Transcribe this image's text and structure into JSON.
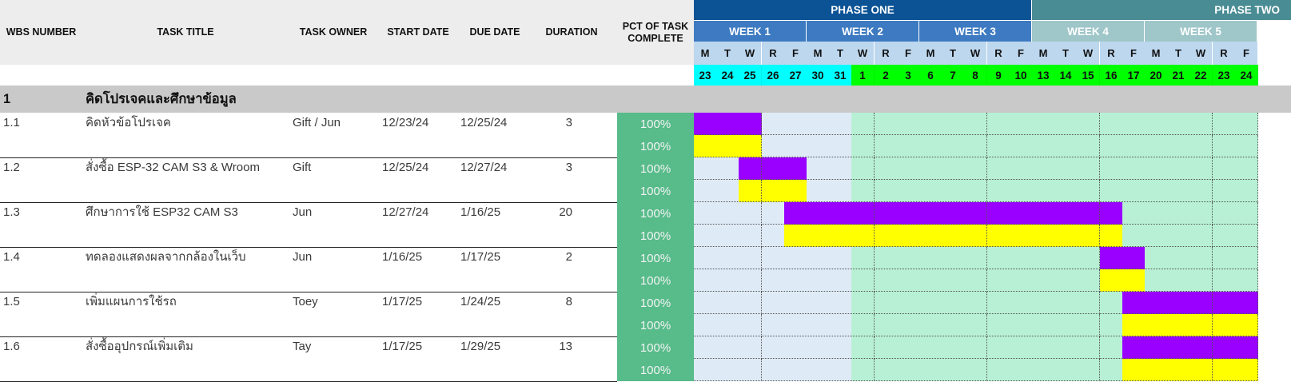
{
  "headers": {
    "wbs": "WBS NUMBER",
    "title": "TASK TITLE",
    "owner": "TASK OWNER",
    "start": "START DATE",
    "due": "DUE DATE",
    "duration": "DURATION",
    "pct_line1": "PCT OF TASK",
    "pct_line2": "COMPLETE"
  },
  "phases": [
    {
      "label": "PHASE ONE",
      "color": "#0b5394"
    },
    {
      "label": "PHASE TWO",
      "color": "#4a8c94"
    }
  ],
  "weeks": [
    {
      "label": "WEEK 1",
      "color": "#3d7ac1"
    },
    {
      "label": "WEEK 2",
      "color": "#3d7ac1"
    },
    {
      "label": "WEEK 3",
      "color": "#3d7ac1"
    },
    {
      "label": "WEEK 4",
      "color": "#9fc6c9"
    },
    {
      "label": "WEEK 5",
      "color": "#9fc6c9"
    }
  ],
  "days": [
    {
      "dow": "M",
      "d": "23"
    },
    {
      "dow": "T",
      "d": "24"
    },
    {
      "dow": "W",
      "d": "25"
    },
    {
      "dow": "R",
      "d": "26"
    },
    {
      "dow": "F",
      "d": "27"
    },
    {
      "dow": "M",
      "d": "30"
    },
    {
      "dow": "T",
      "d": "31"
    },
    {
      "dow": "W",
      "d": "1"
    },
    {
      "dow": "R",
      "d": "2"
    },
    {
      "dow": "F",
      "d": "3"
    },
    {
      "dow": "M",
      "d": "6"
    },
    {
      "dow": "T",
      "d": "7"
    },
    {
      "dow": "W",
      "d": "8"
    },
    {
      "dow": "R",
      "d": "9"
    },
    {
      "dow": "F",
      "d": "10"
    },
    {
      "dow": "M",
      "d": "13"
    },
    {
      "dow": "T",
      "d": "14"
    },
    {
      "dow": "W",
      "d": "15"
    },
    {
      "dow": "R",
      "d": "16"
    },
    {
      "dow": "F",
      "d": "17"
    },
    {
      "dow": "M",
      "d": "20"
    },
    {
      "dow": "T",
      "d": "21"
    },
    {
      "dow": "W",
      "d": "22"
    },
    {
      "dow": "R",
      "d": "23"
    },
    {
      "dow": "F",
      "d": "24"
    }
  ],
  "section": {
    "number": "1",
    "title": "คิดโปรเจคและศึกษาข้อมูล"
  },
  "colors": {
    "plan_bar": "#9900ff",
    "actual_bar": "#ffff00",
    "dec_bg": "#deeaf6",
    "jan_bg": "#b7f0d4",
    "dec_date": "#00ffff",
    "jan_date": "#00ff00",
    "pct_bg": "#57bb8a"
  },
  "tasks": [
    {
      "wbs": "1.1",
      "title": "คิดหัวข้อโปรเจค",
      "owner": "Gift / Jun",
      "start": "12/23/24",
      "due": "12/25/24",
      "duration": "3",
      "pct_plan": "100%",
      "pct_actual": "100%",
      "plan_start": 0,
      "plan_end": 2,
      "act_start": 0,
      "act_end": 2
    },
    {
      "wbs": "1.2",
      "title": "สั่งซื้อ ESP-32 CAM S3 & Wroom",
      "owner": "Gift",
      "start": "12/25/24",
      "due": "12/27/24",
      "duration": "3",
      "pct_plan": "100%",
      "pct_actual": "100%",
      "plan_start": 2,
      "plan_end": 4,
      "act_start": 2,
      "act_end": 4
    },
    {
      "wbs": "1.3",
      "title": "ศึกษาการใช้ ESP32 CAM S3",
      "owner": "Jun",
      "start": "12/27/24",
      "due": "1/16/25",
      "duration": "20",
      "pct_plan": "100%",
      "pct_actual": "100%",
      "plan_start": 4,
      "plan_end": 18,
      "act_start": 4,
      "act_end": 18
    },
    {
      "wbs": "1.4",
      "title": "ทดลองแสดงผลจากกล้องในเว็บ",
      "owner": "Jun",
      "start": "1/16/25",
      "due": "1/17/25",
      "duration": "2",
      "pct_plan": "100%",
      "pct_actual": "100%",
      "plan_start": 18,
      "plan_end": 19,
      "act_start": 18,
      "act_end": 19
    },
    {
      "wbs": "1.5",
      "title": "เพิ่มแผนการใช้รถ",
      "owner": "Toey",
      "start": "1/17/25",
      "due": "1/24/25",
      "duration": "8",
      "pct_plan": "100%",
      "pct_actual": "100%",
      "plan_start": 19,
      "plan_end": 24,
      "act_start": 19,
      "act_end": 24
    },
    {
      "wbs": "1.6",
      "title": "สั่งซื้ออุปกรณ์เพิ่มเติม",
      "owner": "Tay",
      "start": "1/17/25",
      "due": "1/29/25",
      "duration": "13",
      "pct_plan": "100%",
      "pct_actual": "100%",
      "plan_start": 19,
      "plan_end": 24,
      "act_start": 19,
      "act_end": 24
    }
  ]
}
